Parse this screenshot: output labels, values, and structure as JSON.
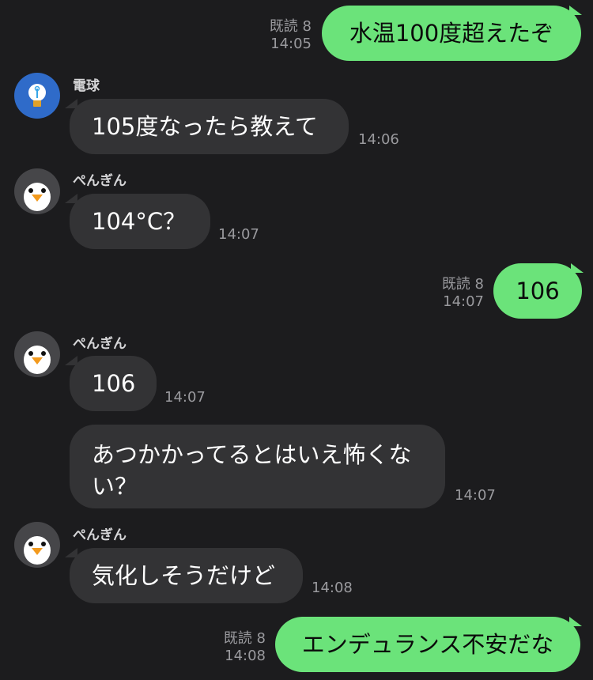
{
  "accent_color": "#6be37a",
  "messages": [
    {
      "text": "水温100度超えたぞ",
      "read": "既読 8",
      "time": "14:05"
    },
    {
      "sender": "電球",
      "text": "105度なったら教えて",
      "time": "14:06"
    },
    {
      "sender": "ぺんぎん",
      "text": "104°C？",
      "time": "14:07"
    },
    {
      "text": "106",
      "read": "既読 8",
      "time": "14:07"
    },
    {
      "sender": "ぺんぎん",
      "text": "106",
      "time": "14:07"
    },
    {
      "text_line1": "あつかかってるとはいえ怖くな",
      "text_line2": "い？",
      "time": "14:07"
    },
    {
      "sender": "ぺんぎん",
      "text": "気化しそうだけど",
      "time": "14:08"
    },
    {
      "text": "エンデュランス不安だな",
      "read": "既読 8",
      "time": "14:08"
    }
  ]
}
